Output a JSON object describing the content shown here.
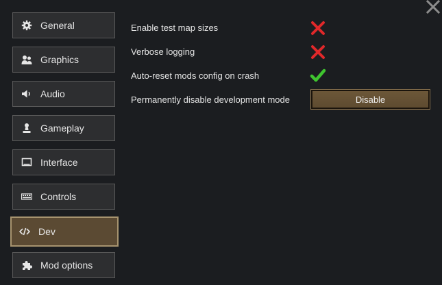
{
  "sidebar": {
    "items": [
      {
        "label": "General",
        "icon": "gear-icon"
      },
      {
        "label": "Graphics",
        "icon": "people-icon"
      },
      {
        "label": "Audio",
        "icon": "speaker-icon"
      },
      {
        "label": "Gameplay",
        "icon": "pawn-icon"
      },
      {
        "label": "Interface",
        "icon": "monitor-icon"
      },
      {
        "label": "Controls",
        "icon": "keyboard-icon"
      },
      {
        "label": "Dev",
        "icon": "code-icon",
        "active": true
      },
      {
        "label": "Mod options",
        "icon": "puzzle-icon"
      }
    ]
  },
  "settings": {
    "enable_test_map_sizes": {
      "label": "Enable test map sizes",
      "value": false
    },
    "verbose_logging": {
      "label": "Verbose logging",
      "value": false
    },
    "auto_reset_mods": {
      "label": "Auto-reset mods config on crash",
      "value": true
    },
    "disable_dev_mode": {
      "label": "Permanently disable development mode",
      "button_label": "Disable"
    }
  },
  "colors": {
    "background": "#1b1d20",
    "active_tab": "#5b4a33",
    "check": "#3fc52f",
    "cross": "#e0282a"
  }
}
